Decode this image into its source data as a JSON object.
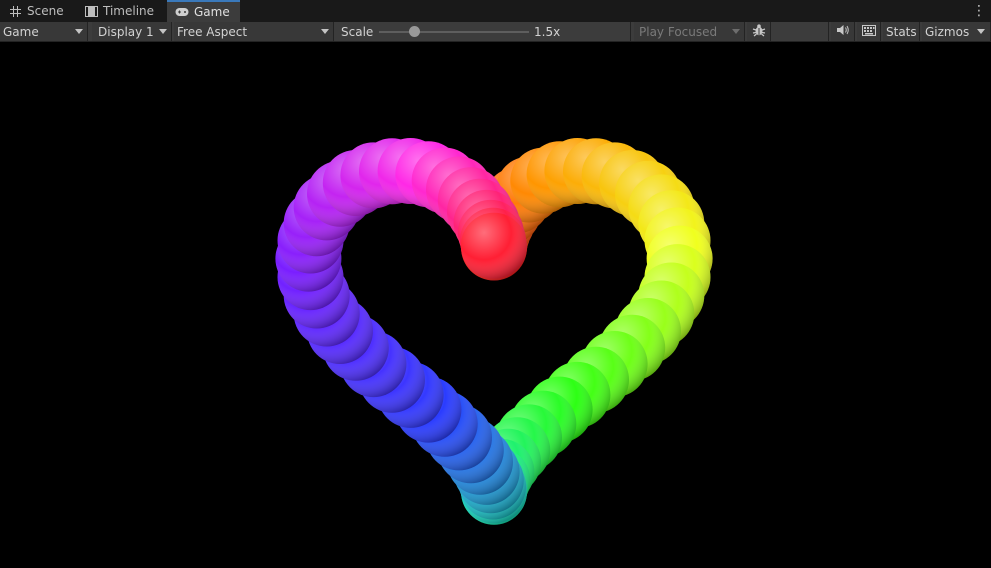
{
  "tabs": [
    {
      "label": "Scene",
      "icon": "grid-icon",
      "active": false
    },
    {
      "label": "Timeline",
      "icon": "film-icon",
      "active": false
    },
    {
      "label": "Game",
      "icon": "gamepad-icon",
      "active": true
    }
  ],
  "toolbar": {
    "view_mode": "Game",
    "display": "Display 1",
    "aspect": "Free Aspect",
    "scale_label": "Scale",
    "scale_value": "1.5x",
    "scale_fraction": 0.23,
    "play_mode": "Play Focused",
    "stats": "Stats",
    "gizmos": "Gizmos"
  },
  "scene": {
    "shape": "heart",
    "segments": 72,
    "gradient": [
      "#ff1e1e",
      "#ff9600",
      "#f0ff1e",
      "#2dff14",
      "#14e6b4",
      "#2a3cff",
      "#7a1eff",
      "#ff28e6",
      "#ff1e1e"
    ],
    "background": "#000000"
  }
}
